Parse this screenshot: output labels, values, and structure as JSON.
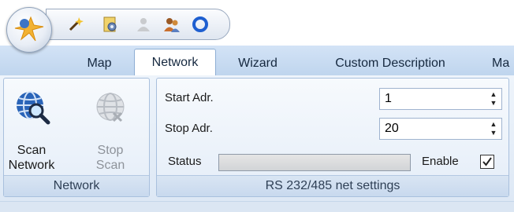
{
  "quick_access": {
    "icons": [
      "wand-icon",
      "document-gear-icon",
      "user-gray-icon",
      "users-icon",
      "ring-icon"
    ]
  },
  "tabs": [
    {
      "label": "Map"
    },
    {
      "label": "Network"
    },
    {
      "label": "Wizard"
    },
    {
      "label": "Custom Description"
    },
    {
      "label": "Ma"
    }
  ],
  "network_group": {
    "scan_button": {
      "line1": "Scan",
      "line2": "Network"
    },
    "stop_button": {
      "line1": "Stop",
      "line2": "Scan"
    },
    "footer": "Network"
  },
  "rs_group": {
    "start_label": "Start Adr.",
    "start_value": "1",
    "stop_label": "Stop Adr.",
    "stop_value": "20",
    "status_label": "Status",
    "status_progress": 0,
    "enable_label": "Enable",
    "enable_checked": true,
    "footer": "RS 232/485 net settings"
  },
  "colors": {
    "ribbon_blue": "#bfd5ee",
    "tab_border": "#8eaed4",
    "text": "#1a1a1a"
  }
}
